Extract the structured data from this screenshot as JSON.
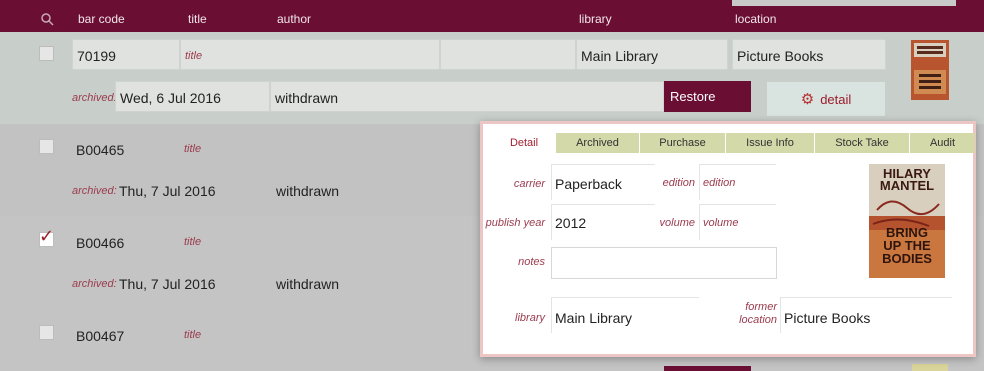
{
  "header": {
    "columns": [
      "bar code",
      "title",
      "author",
      "library",
      "location"
    ]
  },
  "colors": {
    "header_bg": "#6a0f33",
    "accent": "#9a1d2a",
    "tab_bg": "#d3d9a8"
  },
  "rows": [
    {
      "barcode": "70199",
      "title_placeholder": "title",
      "library": "Main Library",
      "location": "Picture Books",
      "archived_label": "archived:",
      "archived_date": "Wed, 6 Jul 2016",
      "status": "withdrawn",
      "restore_label": "Restore",
      "detail_label": "detail",
      "checked": false
    },
    {
      "barcode": "B00465",
      "title_placeholder": "title",
      "archived_label": "archived:",
      "archived_date": "Thu, 7 Jul 2016",
      "status": "withdrawn",
      "checked": false
    },
    {
      "barcode": "B00466",
      "title_placeholder": "title",
      "archived_label": "archived:",
      "archived_date": "Thu, 7 Jul 2016",
      "status": "withdrawn",
      "checked": true
    },
    {
      "barcode": "B00467",
      "title_placeholder": "title",
      "checked": false
    }
  ],
  "popup": {
    "tabs": [
      "Detail",
      "Archived",
      "Purchase",
      "Issue Info",
      "Stock Take",
      "Audit"
    ],
    "carrier_label": "carrier",
    "carrier": "Paperback",
    "edition_label": "edition",
    "edition_placeholder": "edition",
    "publish_year_label": "publish year",
    "publish_year": "2012",
    "volume_label": "volume",
    "volume_placeholder": "volume",
    "notes_label": "notes",
    "library_label": "library",
    "library": "Main Library",
    "former_location_label_1": "former",
    "former_location_label_2": "location",
    "former_location": "Picture Books",
    "cover": {
      "line1": "HILARY",
      "line2": "MANTEL",
      "line3": "BRING",
      "line4": "UP THE",
      "line5": "BODIES"
    }
  }
}
